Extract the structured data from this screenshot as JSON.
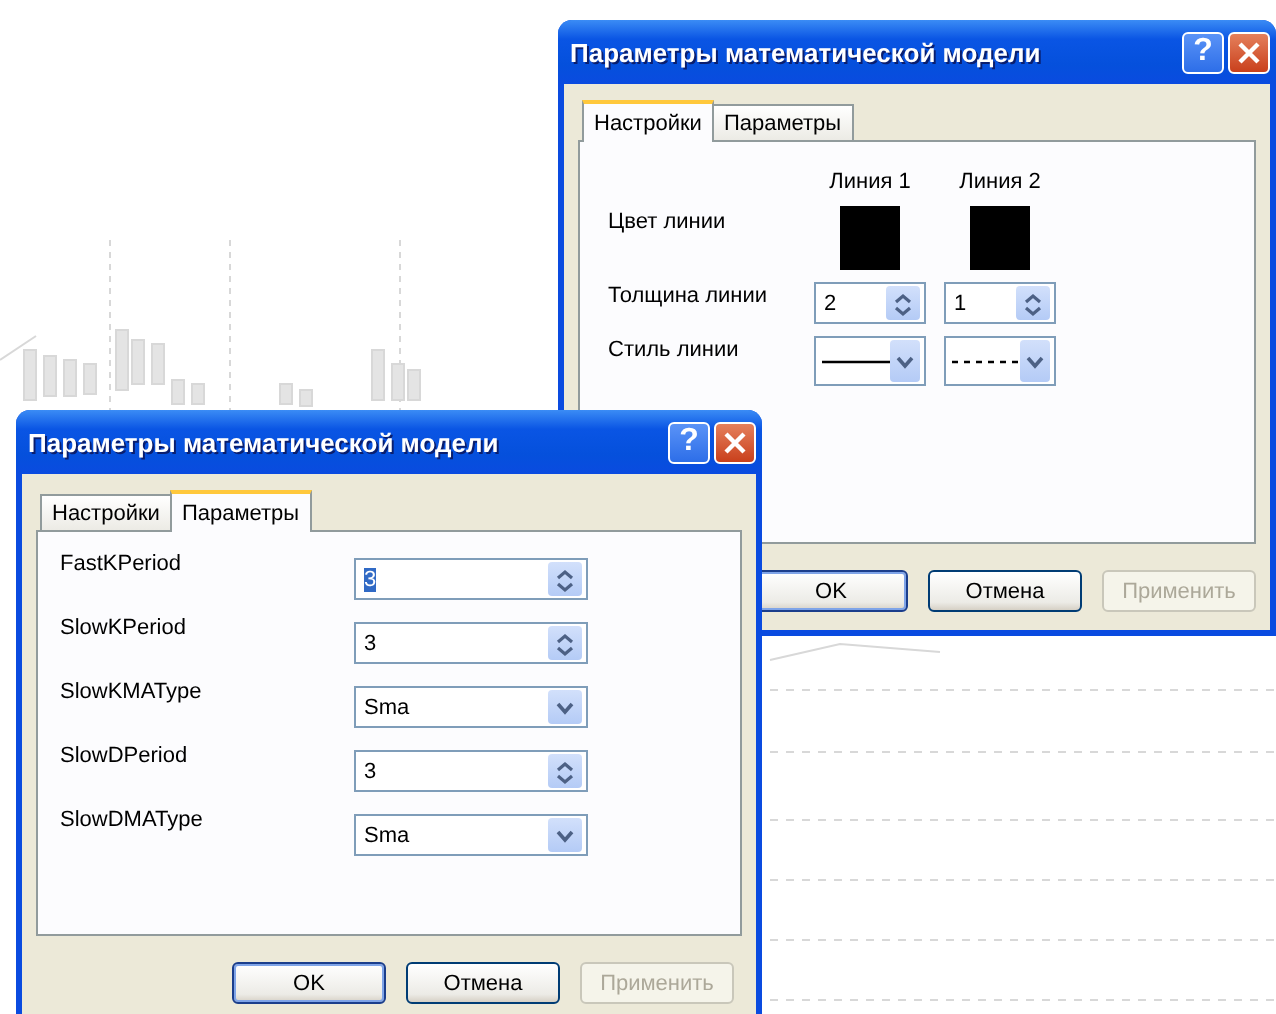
{
  "dialogs": [
    {
      "title": "Параметры математической модели",
      "help": "?",
      "kind": "line-settings",
      "tabs": [
        {
          "label": "Настройки",
          "selected": true
        },
        {
          "label": "Параметры",
          "selected": false
        }
      ],
      "columns": [
        "Линия 1",
        "Линия 2"
      ],
      "rows": [
        {
          "label": "Цвет линии",
          "kind": "color",
          "cells": [
            {
              "color": "#000000"
            },
            {
              "color": "#000000"
            }
          ]
        },
        {
          "label": "Толщина линии",
          "kind": "spin",
          "cells": [
            {
              "value": "2"
            },
            {
              "value": "1"
            }
          ]
        },
        {
          "label": "Стиль линии",
          "kind": "line-style",
          "cells": [
            {
              "dashed": false
            },
            {
              "dashed": true
            }
          ]
        }
      ],
      "buttons": [
        {
          "label": "OK",
          "default": true,
          "disabled": false
        },
        {
          "label": "Отмена",
          "default": false,
          "disabled": false
        },
        {
          "label": "Применить",
          "default": false,
          "disabled": true
        }
      ]
    },
    {
      "title": "Параметры математической модели",
      "help": "?",
      "kind": "parameters",
      "tabs": [
        {
          "label": "Настройки",
          "selected": false
        },
        {
          "label": "Параметры",
          "selected": true
        }
      ],
      "fields": [
        {
          "label": "FastKPeriod",
          "kind": "spin",
          "value": "3",
          "highlighted": true
        },
        {
          "label": "SlowKPeriod",
          "kind": "spin",
          "value": "3",
          "highlighted": false
        },
        {
          "label": "SlowKMAType",
          "kind": "combo",
          "value": "Sma",
          "highlighted": false
        },
        {
          "label": "SlowDPeriod",
          "kind": "spin",
          "value": "3",
          "highlighted": false
        },
        {
          "label": "SlowDMAType",
          "kind": "combo",
          "value": "Sma",
          "highlighted": false
        }
      ],
      "buttons": [
        {
          "label": "OK",
          "default": true,
          "disabled": false
        },
        {
          "label": "Отмена",
          "default": false,
          "disabled": false
        },
        {
          "label": "Применить",
          "default": false,
          "disabled": true
        }
      ]
    }
  ]
}
